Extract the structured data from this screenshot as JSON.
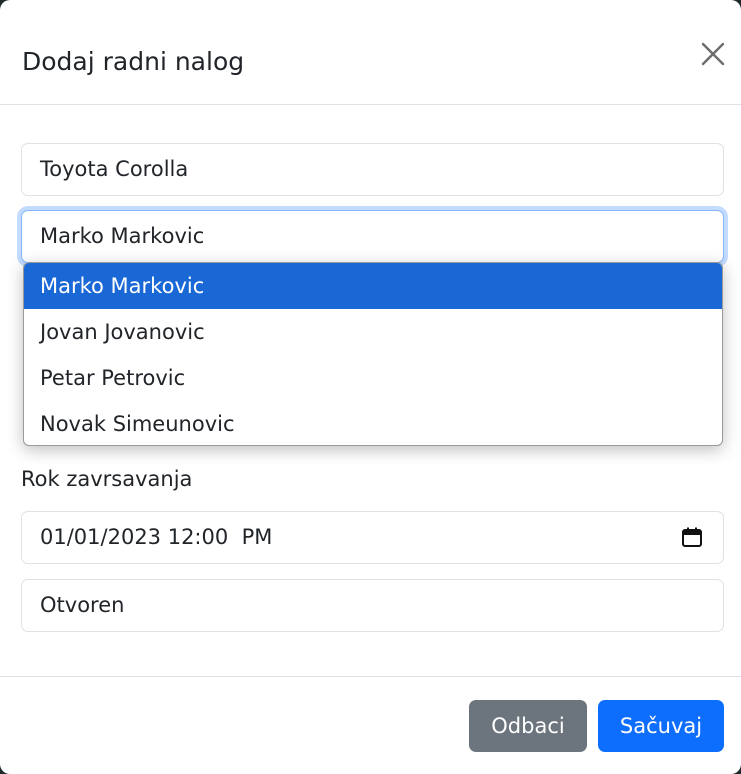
{
  "modal": {
    "title": "Dodaj radni nalog",
    "close_icon": "close-icon"
  },
  "form": {
    "vehicle_value": "Toyota Corolla",
    "mechanic_value": "Marko Markovic",
    "mechanic_options": [
      {
        "label": "Marko Markovic",
        "selected": true
      },
      {
        "label": "Jovan Jovanovic",
        "selected": false
      },
      {
        "label": "Petar Petrovic",
        "selected": false
      },
      {
        "label": "Novak Simeunovic",
        "selected": false
      }
    ],
    "deadline_label": "Rok zavrsavanja",
    "deadline_value": "01/01/2023 12:00  PM",
    "calendar_icon": "calendar-icon",
    "status_value": "Otvoren"
  },
  "footer": {
    "cancel_label": "Odbaci",
    "save_label": "Sačuvaj"
  },
  "colors": {
    "primary": "#0d6efd",
    "secondary": "#6c757d",
    "selected_option": "#1a68d6",
    "focus_border": "#86b7fe"
  }
}
